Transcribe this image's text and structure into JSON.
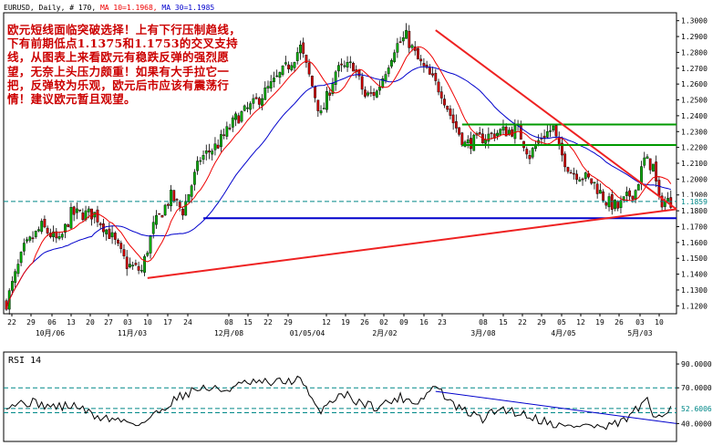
{
  "header": {
    "symbol": "EURUSD",
    "info": ", Daily, # 170, ",
    "ma10_label": "MA 10=1.1968,",
    "ma30_label": "MA 30=1.1985"
  },
  "annotation": "欧元短线面临突破选择！上有下行压制趋线，下有前期低点1.1375和1.1753的交叉支持线，从图表上来看欧元有稳跌反弹的强烈愿望，无奈上头压力颇重！如果有大手拉它一把，反弹较为乐观，欧元后市应该有震荡行情！建议欧元暂且观望。",
  "price_axis": {
    "ticks": [
      "1.3000",
      "1.2900",
      "1.2800",
      "1.2700",
      "1.2600",
      "1.2500",
      "1.2400",
      "1.2300",
      "1.2200",
      "1.2100",
      "1.2000",
      "1.1900",
      "1.1800",
      "1.1700",
      "1.1600",
      "1.1500",
      "1.1400",
      "1.1300",
      "1.1200"
    ],
    "current": "1.1859"
  },
  "x_axis": {
    "days": [
      "22",
      "29",
      "06",
      "13",
      "20",
      "27",
      "03",
      "10",
      "17",
      "24",
      "08",
      "15",
      "22",
      "29",
      "12",
      "19",
      "26",
      "02",
      "09",
      "16",
      "23",
      "08",
      "15",
      "22",
      "29",
      "05",
      "12",
      "19",
      "26",
      "03",
      "10"
    ],
    "months": [
      "10月/06",
      "11月/03",
      "12月/08",
      "01/05/04",
      "2月/02",
      "3月/08",
      "4月/05",
      "5月/03"
    ]
  },
  "rsi": {
    "label": "RSI 14",
    "ticks": [
      "90.0000",
      "70.0000",
      "52.6006",
      "40.0000"
    ],
    "current": "52.6006"
  },
  "colors": {
    "background": "#ffffff",
    "candle_up": "#00aa00",
    "candle_down": "#cc0000",
    "ma10": "#ee0000",
    "ma30": "#0000cc",
    "trendline": "#ee2222",
    "support": "#0000cc",
    "resistance": "#009900",
    "current_price": "#008888",
    "annotation": "#cc0000"
  },
  "chart_data": [
    {
      "type": "candlestick",
      "title": "EURUSD, Daily",
      "ylim": [
        1.115,
        1.305
      ],
      "yticks": [
        1.3,
        1.29,
        1.28,
        1.27,
        1.26,
        1.25,
        1.24,
        1.23,
        1.22,
        1.21,
        1.2,
        1.19,
        1.18,
        1.17,
        1.16,
        1.15,
        1.14,
        1.13,
        1.12
      ],
      "anchors": [
        [
          0,
          1.122
        ],
        [
          6,
          1.156
        ],
        [
          12,
          1.17
        ],
        [
          18,
          1.16
        ],
        [
          22,
          1.178
        ],
        [
          30,
          1.178
        ],
        [
          36,
          1.163
        ],
        [
          41,
          1.146
        ],
        [
          46,
          1.142
        ],
        [
          50,
          1.17
        ],
        [
          56,
          1.189
        ],
        [
          60,
          1.18
        ],
        [
          66,
          1.213
        ],
        [
          72,
          1.222
        ],
        [
          78,
          1.238
        ],
        [
          84,
          1.247
        ],
        [
          90,
          1.259
        ],
        [
          96,
          1.272
        ],
        [
          100,
          1.283
        ],
        [
          103,
          1.265
        ],
        [
          107,
          1.24
        ],
        [
          112,
          1.268
        ],
        [
          118,
          1.272
        ],
        [
          122,
          1.252
        ],
        [
          126,
          1.255
        ],
        [
          132,
          1.283
        ],
        [
          136,
          1.29
        ],
        [
          140,
          1.275
        ],
        [
          144,
          1.265
        ],
        [
          148,
          1.255
        ],
        [
          152,
          1.236
        ],
        [
          156,
          1.222
        ],
        [
          162,
          1.226
        ],
        [
          168,
          1.23
        ],
        [
          174,
          1.231
        ],
        [
          178,
          1.215
        ],
        [
          182,
          1.227
        ],
        [
          186,
          1.232
        ],
        [
          188,
          1.218
        ],
        [
          192,
          1.205
        ],
        [
          196,
          1.202
        ],
        [
          200,
          1.197
        ],
        [
          204,
          1.186
        ],
        [
          208,
          1.182
        ],
        [
          212,
          1.19
        ],
        [
          214,
          1.193
        ],
        [
          217,
          1.212
        ],
        [
          220,
          1.208
        ],
        [
          222,
          1.186
        ],
        [
          226,
          1.186
        ]
      ],
      "ma10": {
        "name": "MA 10",
        "value": 1.1968
      },
      "ma30": {
        "name": "MA 30",
        "value": 1.1985
      },
      "current_price": 1.1859,
      "support_levels": [
        1.1753,
        1.2215
      ],
      "resistance_levels": [
        1.2345
      ],
      "trendline_down": {
        "from": [
          146,
          1.294
        ],
        "to": [
          226,
          1.181
        ]
      },
      "trendline_up": {
        "from": [
          48,
          1.1375
        ],
        "to": [
          226,
          1.181
        ]
      }
    },
    {
      "type": "line",
      "title": "RSI 14",
      "ylim": [
        25,
        100
      ],
      "yticks": [
        90,
        70,
        52.6006,
        40
      ],
      "anchors": [
        [
          0,
          56
        ],
        [
          8,
          58
        ],
        [
          16,
          54
        ],
        [
          24,
          55
        ],
        [
          30,
          46
        ],
        [
          38,
          43
        ],
        [
          46,
          40
        ],
        [
          52,
          50
        ],
        [
          58,
          62
        ],
        [
          66,
          70
        ],
        [
          74,
          68
        ],
        [
          82,
          74
        ],
        [
          90,
          74
        ],
        [
          100,
          77
        ],
        [
          106,
          50
        ],
        [
          114,
          66
        ],
        [
          120,
          58
        ],
        [
          126,
          54
        ],
        [
          134,
          62
        ],
        [
          140,
          58
        ],
        [
          146,
          72
        ],
        [
          152,
          55
        ],
        [
          158,
          48
        ],
        [
          162,
          44
        ],
        [
          168,
          53
        ],
        [
          176,
          48
        ],
        [
          182,
          43
        ],
        [
          190,
          37
        ],
        [
          196,
          39
        ],
        [
          204,
          36
        ],
        [
          210,
          42
        ],
        [
          214,
          51
        ],
        [
          218,
          58
        ],
        [
          220,
          46
        ],
        [
          226,
          53
        ]
      ],
      "current": 52.6006,
      "trendline": {
        "from": [
          146,
          67
        ],
        "to": [
          226,
          40
        ]
      }
    }
  ]
}
